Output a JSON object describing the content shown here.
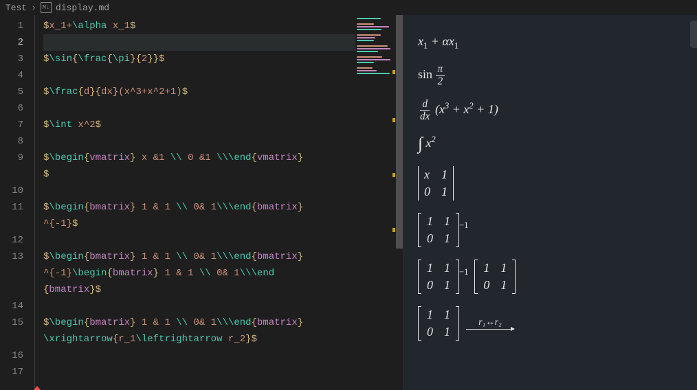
{
  "breadcrumb": {
    "root": "Test",
    "file": "display.md"
  },
  "editor": {
    "activeLine": 2,
    "lines": [
      {
        "num": 1,
        "segments": [
          [
            "$",
            "delim"
          ],
          [
            "x_1+",
            "text"
          ],
          [
            "\\alpha",
            "cmd"
          ],
          [
            " x_1",
            "text"
          ],
          [
            "$",
            "delim"
          ]
        ]
      },
      {
        "num": 2,
        "segments": []
      },
      {
        "num": 3,
        "segments": [
          [
            "$",
            "delim"
          ],
          [
            "\\sin",
            "cmd"
          ],
          [
            "{",
            "delim"
          ],
          [
            "\\frac",
            "cmd"
          ],
          [
            "{",
            "delim"
          ],
          [
            "\\pi",
            "cmd"
          ],
          [
            "}{",
            "delim"
          ],
          [
            "2",
            "text"
          ],
          [
            "}}",
            "delim"
          ],
          [
            "$",
            "delim"
          ]
        ]
      },
      {
        "num": 4,
        "segments": []
      },
      {
        "num": 5,
        "segments": [
          [
            "$",
            "delim"
          ],
          [
            "\\frac",
            "cmd"
          ],
          [
            "{",
            "delim"
          ],
          [
            "d",
            "text"
          ],
          [
            "}{",
            "delim"
          ],
          [
            "dx",
            "text"
          ],
          [
            "}",
            "delim"
          ],
          [
            "(x^3+x^2+1)",
            "text"
          ],
          [
            "$",
            "delim"
          ]
        ]
      },
      {
        "num": 6,
        "segments": []
      },
      {
        "num": 7,
        "segments": [
          [
            "$",
            "delim"
          ],
          [
            "\\int",
            "cmd"
          ],
          [
            " x^2",
            "text"
          ],
          [
            "$",
            "delim"
          ]
        ]
      },
      {
        "num": 8,
        "segments": []
      },
      {
        "num": 9,
        "segments": [
          [
            "$",
            "delim"
          ],
          [
            "\\begin",
            "cmd"
          ],
          [
            "{",
            "delim"
          ],
          [
            "vmatrix",
            "kw"
          ],
          [
            "}",
            "delim"
          ],
          [
            " x &1 ",
            "text"
          ],
          [
            "\\\\",
            "cmd"
          ],
          [
            " 0 &1 ",
            "text"
          ],
          [
            "\\\\",
            "cmd"
          ],
          [
            "\\end",
            "cmd"
          ],
          [
            "{",
            "delim"
          ],
          [
            "vmatrix",
            "kw"
          ],
          [
            "}",
            "delim"
          ]
        ]
      },
      {
        "num": null,
        "segments": [
          [
            "$",
            "delim"
          ]
        ]
      },
      {
        "num": 10,
        "segments": []
      },
      {
        "num": 11,
        "segments": [
          [
            "$",
            "delim"
          ],
          [
            "\\begin",
            "cmd"
          ],
          [
            "{",
            "delim"
          ],
          [
            "bmatrix",
            "kw"
          ],
          [
            "}",
            "delim"
          ],
          [
            " 1 & 1 ",
            "text"
          ],
          [
            "\\\\",
            "cmd"
          ],
          [
            " 0& 1",
            "text"
          ],
          [
            "\\\\",
            "cmd"
          ],
          [
            "\\end",
            "cmd"
          ],
          [
            "{",
            "delim"
          ],
          [
            "bmatrix",
            "kw"
          ],
          [
            "}",
            "delim"
          ]
        ]
      },
      {
        "num": null,
        "segments": [
          [
            "^{-1}",
            "text"
          ],
          [
            "$",
            "delim"
          ]
        ]
      },
      {
        "num": 12,
        "segments": []
      },
      {
        "num": 13,
        "segments": [
          [
            "$",
            "delim"
          ],
          [
            "\\begin",
            "cmd"
          ],
          [
            "{",
            "delim"
          ],
          [
            "bmatrix",
            "kw"
          ],
          [
            "}",
            "delim"
          ],
          [
            " 1 & 1 ",
            "text"
          ],
          [
            "\\\\",
            "cmd"
          ],
          [
            " 0& 1",
            "text"
          ],
          [
            "\\\\",
            "cmd"
          ],
          [
            "\\end",
            "cmd"
          ],
          [
            "{",
            "delim"
          ],
          [
            "bmatrix",
            "kw"
          ],
          [
            "}",
            "delim"
          ]
        ]
      },
      {
        "num": null,
        "segments": [
          [
            "^{-1}",
            "text"
          ],
          [
            "\\begin",
            "cmd"
          ],
          [
            "{",
            "delim"
          ],
          [
            "bmatrix",
            "kw"
          ],
          [
            "}",
            "delim"
          ],
          [
            " 1 & 1 ",
            "text"
          ],
          [
            "\\\\",
            "cmd"
          ],
          [
            " 0& 1",
            "text"
          ],
          [
            "\\\\",
            "cmd"
          ],
          [
            "\\end",
            "cmd"
          ]
        ]
      },
      {
        "num": null,
        "segments": [
          [
            "{",
            "delim"
          ],
          [
            "bmatrix",
            "kw"
          ],
          [
            "}",
            "delim"
          ],
          [
            "$",
            "delim"
          ]
        ]
      },
      {
        "num": 14,
        "segments": []
      },
      {
        "num": 15,
        "segments": [
          [
            "$",
            "delim"
          ],
          [
            "\\begin",
            "cmd"
          ],
          [
            "{",
            "delim"
          ],
          [
            "bmatrix",
            "kw"
          ],
          [
            "}",
            "delim"
          ],
          [
            " 1 & 1 ",
            "text"
          ],
          [
            "\\\\",
            "cmd"
          ],
          [
            " 0& 1",
            "text"
          ],
          [
            "\\\\",
            "cmd"
          ],
          [
            "\\end",
            "cmd"
          ],
          [
            "{",
            "delim"
          ],
          [
            "bmatrix",
            "kw"
          ],
          [
            "}",
            "delim"
          ]
        ]
      },
      {
        "num": null,
        "segments": [
          [
            "\\xrightarrow",
            "cmd"
          ],
          [
            "{",
            "delim"
          ],
          [
            "r_1",
            "text"
          ],
          [
            "\\leftrightarrow",
            "cmd"
          ],
          [
            " r_2",
            "text"
          ],
          [
            "}",
            "delim"
          ],
          [
            "$",
            "delim"
          ]
        ]
      },
      {
        "num": 16,
        "segments": []
      },
      {
        "num": 17,
        "segments": []
      }
    ]
  },
  "preview": {
    "items": [
      {
        "type": "expr1",
        "text": "x₁ + αx₁"
      },
      {
        "type": "sin",
        "label": "sin",
        "num": "π",
        "den": "2"
      },
      {
        "type": "deriv",
        "num": "d",
        "den": "dx",
        "body": "(x³ + x² + 1)"
      },
      {
        "type": "int",
        "sym": "∫",
        "body": "x²"
      },
      {
        "type": "vmatrix",
        "cells": [
          "x",
          "1",
          "0",
          "1"
        ]
      },
      {
        "type": "bmatrix_inv",
        "cells": [
          "1",
          "1",
          "0",
          "1"
        ],
        "sup": "−1"
      },
      {
        "type": "bmatrix_inv_prod",
        "cellsA": [
          "1",
          "1",
          "0",
          "1"
        ],
        "sup": "−1",
        "cellsB": [
          "1",
          "1",
          "0",
          "1"
        ]
      },
      {
        "type": "bmatrix_arrow",
        "cells": [
          "1",
          "1",
          "0",
          "1"
        ],
        "over": "r₁↔r₂"
      }
    ]
  }
}
